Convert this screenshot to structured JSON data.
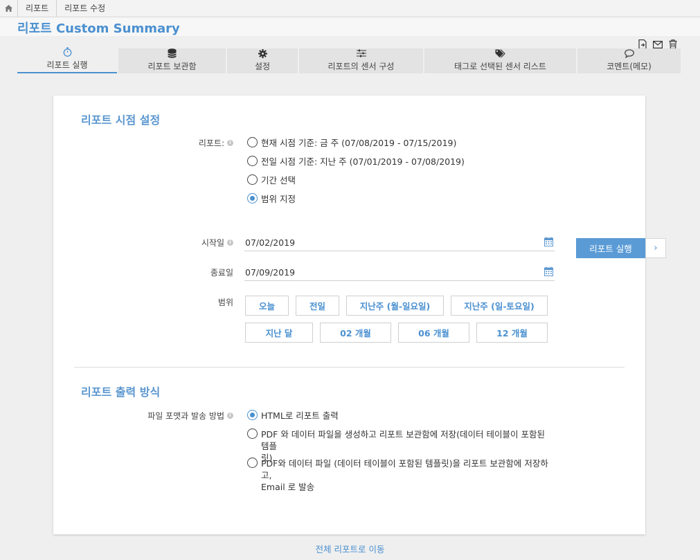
{
  "breadcrumb": [
    "리포트",
    "리포트 수정"
  ],
  "page_title": "리포트 Custom Summary",
  "toolbar_icons": [
    "export-file-icon",
    "mail-icon",
    "trash-icon"
  ],
  "tabs": [
    {
      "label": "리포트 실행",
      "icon": "stopwatch-icon",
      "active": true
    },
    {
      "label": "리포트 보관함",
      "icon": "database-icon",
      "active": false
    },
    {
      "label": "설정",
      "icon": "gear-icon",
      "active": false
    },
    {
      "label": "리포트의 센서 구성",
      "icon": "sliders-icon",
      "active": false
    },
    {
      "label": "태그로 선택된 센서 리스트",
      "icon": "tags-icon",
      "active": false
    },
    {
      "label": "코멘트(메모)",
      "icon": "comment-icon",
      "active": false
    }
  ],
  "time_section": {
    "title": "리포트 시점 설정",
    "report_label": "리포트:",
    "options": [
      {
        "label": "현재 시점 기준: 금 주 (07/08/2019 - 07/15/2019)",
        "checked": false
      },
      {
        "label": "전일 시점 기준: 지난 주 (07/01/2019 - 07/08/2019)",
        "checked": false
      },
      {
        "label": "기간 선택",
        "checked": false
      },
      {
        "label": "범위 지정",
        "checked": true
      }
    ],
    "start_label": "시작일",
    "start_value": "07/02/2019",
    "end_label": "종료일",
    "end_value": "07/09/2019",
    "range_label": "범위",
    "range_buttons_row1": [
      "오늘",
      "전일",
      "지난주 (월-일요일)",
      "지난주 (일-토요일)"
    ],
    "range_buttons_row2": [
      "지난 달",
      "02 개월",
      "06 개월",
      "12 개월"
    ]
  },
  "run_button": {
    "label": "리포트 실행",
    "arrow": "›"
  },
  "output_section": {
    "title": "리포트 출력 방식",
    "format_label": "파일 포맷과 발송 방법",
    "options": [
      {
        "lines": [
          "HTML로 리포트 출력"
        ],
        "checked": true
      },
      {
        "lines": [
          "PDF 와 데이터 파일을 생성하고 리포트 보관함에 저장(데이터 테이블이 포함된 템플",
          "릿)."
        ],
        "checked": false
      },
      {
        "lines": [
          "PDF와 데이터 파일 (데이터 테이블이 포함된 템플릿)을 리포트 보관함에 저장하고,",
          "Email 로 발송"
        ],
        "checked": false
      }
    ]
  },
  "footer_link": "전체 리포트로 이동",
  "colors": {
    "accent": "#4a90d0",
    "button": "#5a9bd6"
  }
}
